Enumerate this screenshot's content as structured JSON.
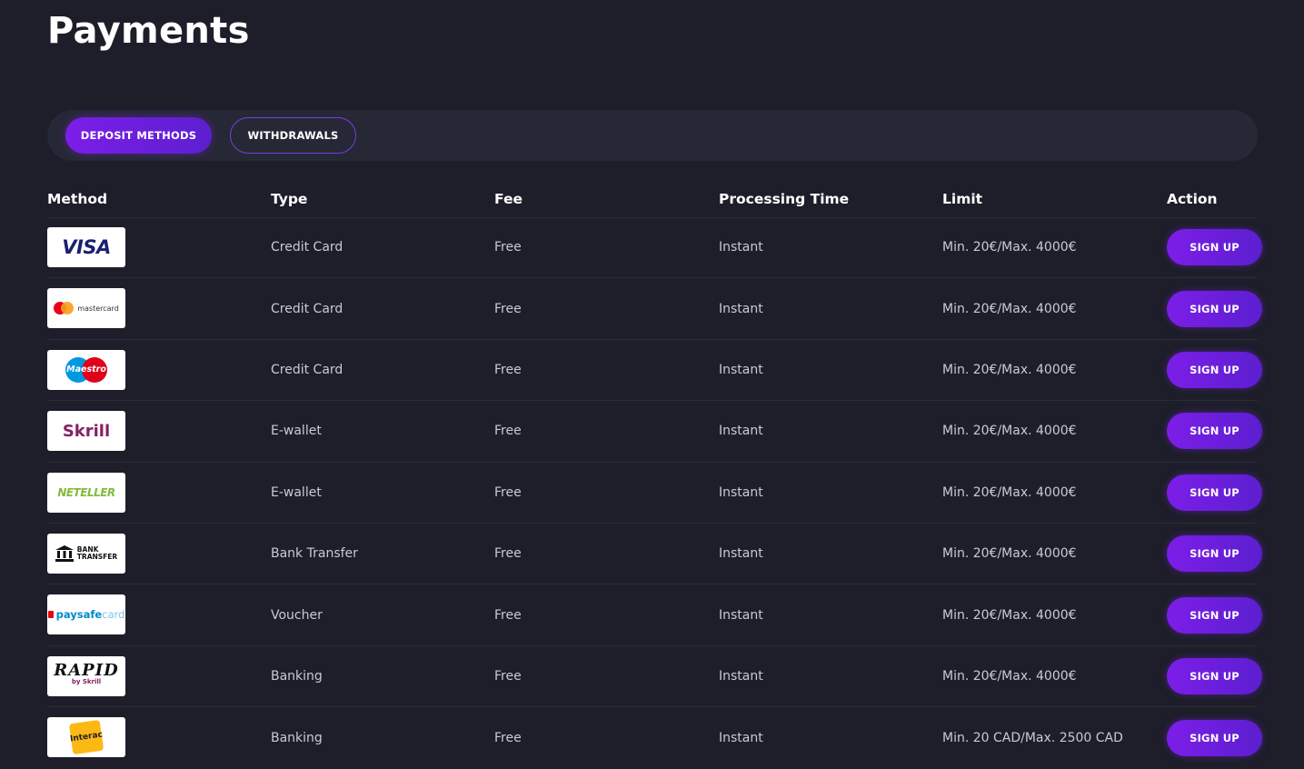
{
  "page": {
    "title": "Payments"
  },
  "tabs": [
    {
      "label": "DEPOSIT METHODS",
      "active": true
    },
    {
      "label": "WITHDRAWALS",
      "active": false
    }
  ],
  "table": {
    "headers": {
      "method": "Method",
      "type": "Type",
      "fee": "Fee",
      "processing_time": "Processing Time",
      "limit": "Limit",
      "action": "Action"
    },
    "rows": [
      {
        "method": "VISA",
        "type": "Credit Card",
        "fee": "Free",
        "time": "Instant",
        "limit": "Min. 20€/Max. 4000€",
        "action": "SIGN UP"
      },
      {
        "method": "mastercard",
        "type": "Credit Card",
        "fee": "Free",
        "time": "Instant",
        "limit": "Min. 20€/Max. 4000€",
        "action": "SIGN UP"
      },
      {
        "method": "Maestro",
        "type": "Credit Card",
        "fee": "Free",
        "time": "Instant",
        "limit": "Min. 20€/Max. 4000€",
        "action": "SIGN UP"
      },
      {
        "method": "Skrill",
        "type": "E-wallet",
        "fee": "Free",
        "time": "Instant",
        "limit": "Min. 20€/Max. 4000€",
        "action": "SIGN UP"
      },
      {
        "method": "NETELLER",
        "type": "E-wallet",
        "fee": "Free",
        "time": "Instant",
        "limit": "Min. 20€/Max. 4000€",
        "action": "SIGN UP"
      },
      {
        "method": "BANK TRANSFER",
        "type": "Bank Transfer",
        "fee": "Free",
        "time": "Instant",
        "limit": "Min. 20€/Max. 4000€",
        "action": "SIGN UP"
      },
      {
        "method": "paysafecard",
        "type": "Voucher",
        "fee": "Free",
        "time": "Instant",
        "limit": "Min. 20€/Max. 4000€",
        "action": "SIGN UP"
      },
      {
        "method": "RAPID by Skrill",
        "type": "Banking",
        "fee": "Free",
        "time": "Instant",
        "limit": "Min. 20€/Max. 4000€",
        "action": "SIGN UP"
      },
      {
        "method": "Interac",
        "type": "Banking",
        "fee": "Free",
        "time": "Instant",
        "limit": "Min. 20 CAD/Max. 2500 CAD",
        "action": "SIGN UP"
      }
    ]
  },
  "logos": {
    "visa": "VISA",
    "mastercard": "mastercard",
    "maestro": "Maestro",
    "skrill": "Skrill",
    "neteller": "NETELLER",
    "bank_line1": "BANK",
    "bank_line2": "TRANSFER",
    "paysafe_a": "paysafe",
    "paysafe_b": "card",
    "rapid": "RAPID",
    "rapid_by": "by Skrill",
    "interac": "Interac"
  },
  "colors": {
    "background": "#1d1e29",
    "tabs_bar": "#262836",
    "accent_purple": "#7c1ee8",
    "text_muted": "#c9cad3"
  }
}
